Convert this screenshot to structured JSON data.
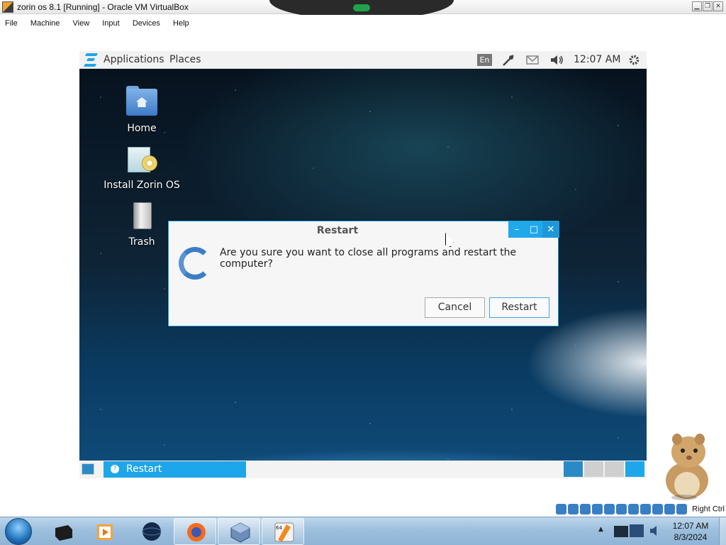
{
  "host_window": {
    "title": "zorin os 8.1 [Running] - Oracle VM VirtualBox",
    "menu": [
      "File",
      "Machine",
      "View",
      "Input",
      "Devices",
      "Help"
    ]
  },
  "guest": {
    "top_panel": {
      "applications_label": "Applications",
      "places_label": "Places",
      "keyboard_layout": "En",
      "clock": "12:07 AM",
      "tray_icons": [
        "network-icon",
        "mail-icon",
        "volume-icon",
        "settings-gear-icon"
      ]
    },
    "desktop_icons": [
      {
        "label": "Home",
        "icon": "home-folder-icon"
      },
      {
        "label": "Install Zorin OS",
        "icon": "installer-icon"
      },
      {
        "label": "Trash",
        "icon": "trash-icon"
      }
    ],
    "dialog": {
      "title": "Restart",
      "message": "Are you sure you want to close all programs and restart the computer?",
      "cancel_label": "Cancel",
      "confirm_label": "Restart",
      "window_buttons": [
        "–",
        "□",
        "✕"
      ]
    },
    "taskbar": {
      "task_label": "Restart",
      "workspace_active": 1,
      "workspaces": 4
    }
  },
  "virtualbox_status": {
    "host_key": "Right Ctrl"
  },
  "host_taskbar": {
    "clock_time": "12:07 AM",
    "clock_date": "8/3/2024",
    "badge_64": "64"
  },
  "colors": {
    "accent": "#1da6ea",
    "dialog_border": "#1fa3e2",
    "refresh_icon": "#3c7ec6"
  }
}
